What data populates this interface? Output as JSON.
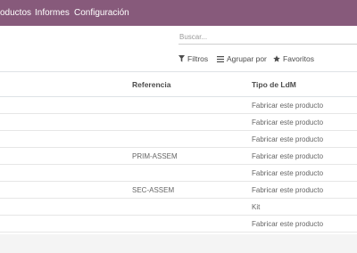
{
  "navbar": {
    "items": [
      "oductos",
      "Informes",
      "Configuración"
    ],
    "color": "#875a7b"
  },
  "search": {
    "placeholder": "Buscar..."
  },
  "filters": {
    "filters_label": "Filtros",
    "groupby_label": "Agrupar por",
    "favorites_label": "Favoritos"
  },
  "table": {
    "columns": [
      "Referencia",
      "Tipo de LdM"
    ],
    "rows": [
      {
        "referencia": "",
        "tipo": "Fabricar este producto"
      },
      {
        "referencia": "",
        "tipo": "Fabricar este producto"
      },
      {
        "referencia": "",
        "tipo": "Fabricar este producto"
      },
      {
        "referencia": "PRIM-ASSEM",
        "tipo": "Fabricar este producto"
      },
      {
        "referencia": "",
        "tipo": "Fabricar este producto"
      },
      {
        "referencia": "SEC-ASSEM",
        "tipo": "Fabricar este producto"
      },
      {
        "referencia": "",
        "tipo": "Kit"
      },
      {
        "referencia": "",
        "tipo": "Fabricar este producto"
      }
    ]
  }
}
